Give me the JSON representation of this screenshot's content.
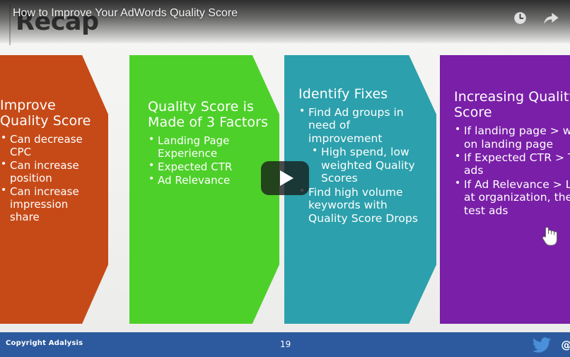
{
  "player": {
    "video_title": "How to Improve Your AdWords Quality Score",
    "watch_later_icon": "clock-icon",
    "share_icon": "share-arrow-icon",
    "play_icon": "play-triangle-icon"
  },
  "slide": {
    "heading": "Recap",
    "panels": [
      {
        "color": "#c64a18",
        "title": "Improve Quality Score",
        "bullets": [
          {
            "text": "Can decrease CPC",
            "level": 1
          },
          {
            "text": "Can increase position",
            "level": 1
          },
          {
            "text": "Can increase impression share",
            "level": 1
          }
        ]
      },
      {
        "color": "#4ed02a",
        "title": "Quality Score is Made of 3 Factors",
        "bullets": [
          {
            "text": "Landing Page Experience",
            "level": 1
          },
          {
            "text": "Expected CTR",
            "level": 1
          },
          {
            "text": "Ad Relevance",
            "level": 1
          }
        ]
      },
      {
        "color": "#2ca0ac",
        "title": "Identify Fixes",
        "bullets": [
          {
            "text": "Find Ad groups in need of improvement",
            "level": 1
          },
          {
            "text": "High spend, low weighted Quality Scores",
            "level": 2
          },
          {
            "text": "Find high volume keywords with Quality Score Drops",
            "level": 1
          }
        ]
      },
      {
        "color": "#7a1fa8",
        "title": "Increasing Quality Score",
        "bullets": [
          {
            "text": "If landing page > work on landing page",
            "level": 1
          },
          {
            "text": "If Expected CTR > Test ads",
            "level": 1
          },
          {
            "text": "If Ad Relevance > Look at organization, then test ads",
            "level": 1
          }
        ]
      }
    ]
  },
  "footer": {
    "copyright": "Copyright Adalysis",
    "page_number": "19",
    "twitter_icon": "twitter-bird-icon",
    "handle": "@A",
    "bar_color": "#2d5a9e"
  }
}
